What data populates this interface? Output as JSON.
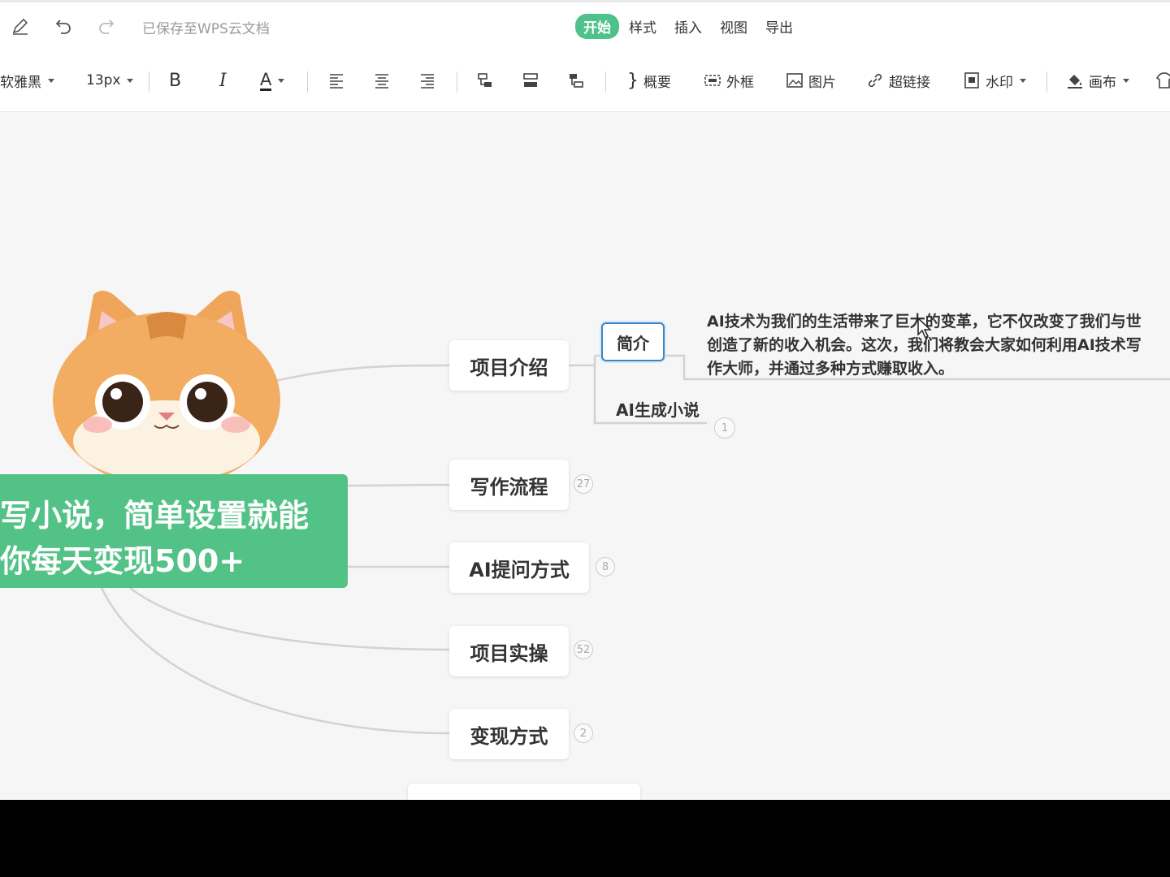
{
  "topbar": {
    "save_status": "已保存至WPS云文档",
    "menu": [
      "开始",
      "样式",
      "插入",
      "视图",
      "导出"
    ],
    "active_menu": "开始"
  },
  "toolbar": {
    "font_family": "软雅黑",
    "font_size": "13px",
    "bold": "B",
    "italic": "I",
    "font_color": "A",
    "summary": "概要",
    "frame": "外框",
    "image": "图片",
    "hyperlink": "超链接",
    "watermark": "水印",
    "canvas": "画布"
  },
  "mindmap": {
    "root": {
      "line1": "写小说，简单设置就能",
      "line2": "你每天变现500+"
    },
    "branches": [
      {
        "label": "项目介绍"
      },
      {
        "label": "写作流程",
        "count": "27"
      },
      {
        "label": "AI提问方式",
        "count": "8"
      },
      {
        "label": "项目实操",
        "count": "52"
      },
      {
        "label": "变现方式",
        "count": "2"
      }
    ],
    "intro": {
      "label": "简介",
      "text_lines": [
        "AI技术为我们的生活带来了巨大的变革，它不仅改变了我们与世",
        "创造了新的收入机会。这次，我们将教会大家如何利用AI技术写",
        "作大师，并通过多种方式赚取收入。"
      ]
    },
    "ai_novel": {
      "label": "AI生成小说",
      "count": "1"
    }
  }
}
